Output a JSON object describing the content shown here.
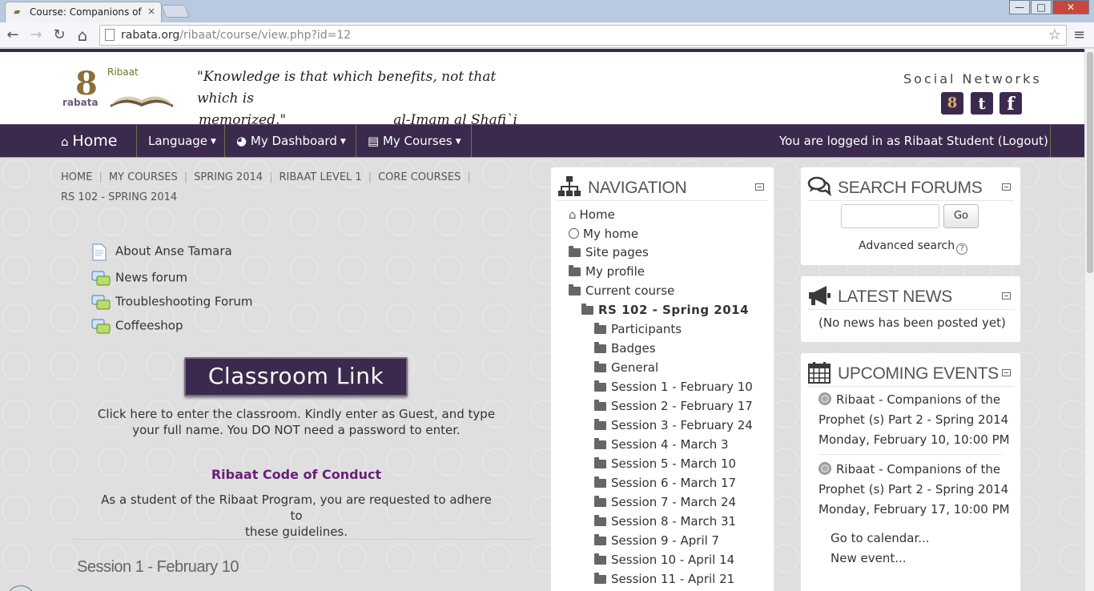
{
  "browser": {
    "tab_title": "Course: Companions of th",
    "tab_close": "×",
    "url_host": "rabata.org",
    "url_path": "/ribaat/course/view.php?id=12",
    "buttons": {
      "back": "←",
      "forward": "→",
      "reload": "↻",
      "home": "⌂",
      "star": "☆",
      "menu": "≡",
      "minimize": "—",
      "maximize": "□",
      "close": "✕"
    }
  },
  "header": {
    "logo_top": "Ribaat",
    "logo_bottom": "rabata",
    "logo_eight": "8",
    "quote_line1": "\"Knowledge is that which benefits, not that which is",
    "quote_line2a": "memorized.\"",
    "quote_line2b": "al-Imam al Shafi`i",
    "social_title": "Social Networks",
    "social": {
      "rabata": "8",
      "twitter": "t",
      "facebook": "f"
    }
  },
  "navbar": {
    "home": "Home",
    "language": "Language",
    "dashboard": "My Dashboard",
    "courses": "My Courses",
    "login_status": "You are logged in as Ribaat Student (Logout)"
  },
  "breadcrumb": [
    "HOME",
    "MY COURSES",
    "SPRING 2014",
    "RIBAAT LEVEL 1",
    "CORE COURSES",
    "RS 102 - SPRING 2014"
  ],
  "activities": [
    "About Anse Tamara",
    "News forum",
    "Troubleshooting Forum",
    "Coffeeshop"
  ],
  "classroom": {
    "button": "Classroom Link",
    "text1": "Click here to enter the classroom. Kindly enter as Guest, and type",
    "text2": "your full name. You DO NOT need a password to enter."
  },
  "code_of_conduct": {
    "title": "Ribaat Code of Conduct",
    "text1": "As a student of the Ribaat Program, you are requested to adhere to",
    "text2": "these guidelines."
  },
  "section_heading": "Session 1 - February 10",
  "navigation": {
    "title": "NAVIGATION",
    "home": "Home",
    "my_home": "My home",
    "site_pages": "Site pages",
    "my_profile": "My profile",
    "current_course": "Current course",
    "course": "RS 102 - Spring 2014",
    "items": [
      "Participants",
      "Badges",
      "General",
      "Session 1 - February 10",
      "Session 2 - February 17",
      "Session 3 - February 24",
      "Session 4 - March 3",
      "Session 5 - March 10",
      "Session 6 - March 17",
      "Session 7 - March 24",
      "Session 8 - March 31",
      "Session 9 - April 7",
      "Session 10 - April 14",
      "Session 11 - April 21"
    ]
  },
  "search_forums": {
    "title": "SEARCH FORUMS",
    "go": "Go",
    "advanced": "Advanced search",
    "help": "?"
  },
  "latest_news": {
    "title": "LATEST NEWS",
    "empty": "(No news has been posted yet)"
  },
  "upcoming_events": {
    "title": "UPCOMING EVENTS",
    "events": [
      {
        "line1": "Ribaat - Companions of the",
        "line2": "Prophet (s) Part 2 - Spring 2014",
        "date": "Monday, February 10, 10:00 PM"
      },
      {
        "line1": "Ribaat - Companions of the",
        "line2": "Prophet (s) Part 2 - Spring 2014",
        "date": "Monday, February 17, 10:00 PM"
      }
    ],
    "calendar": "Go to calendar...",
    "new_event": "New event..."
  },
  "colors": {
    "brand_purple": "#3b2a4d",
    "link_purple": "#6a1e78",
    "olive": "#a7a86a"
  }
}
